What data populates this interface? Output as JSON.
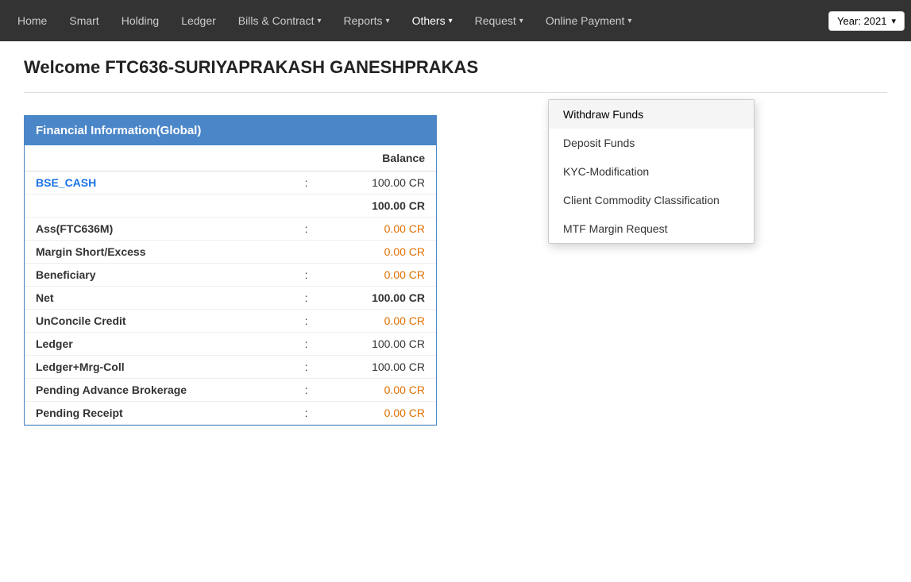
{
  "navbar": {
    "items": [
      {
        "id": "home",
        "label": "Home",
        "hasArrow": false
      },
      {
        "id": "smart",
        "label": "Smart",
        "hasArrow": false
      },
      {
        "id": "holding",
        "label": "Holding",
        "hasArrow": false
      },
      {
        "id": "ledger",
        "label": "Ledger",
        "hasArrow": false
      },
      {
        "id": "bills-contract",
        "label": "Bills & Contract",
        "hasArrow": true
      },
      {
        "id": "reports",
        "label": "Reports",
        "hasArrow": true
      },
      {
        "id": "others",
        "label": "Others",
        "hasArrow": true
      },
      {
        "id": "request",
        "label": "Request",
        "hasArrow": true
      },
      {
        "id": "online-payment",
        "label": "Online Payment",
        "hasArrow": true
      }
    ],
    "year_label": "Year: 2021"
  },
  "welcome": {
    "text": "Welcome FTC636-SURIYAPRAKASH GANESHPRAKAS"
  },
  "financial_table": {
    "header": "Financial Information(Global)",
    "column_balance": "Balance",
    "rows": [
      {
        "label": "BSE_CASH",
        "colon": ":",
        "value": "100.00 CR",
        "type": "link",
        "value_style": "normal"
      },
      {
        "label": "",
        "colon": "",
        "value": "100.00 CR",
        "type": "summary",
        "value_style": "bold"
      },
      {
        "label": "Ass(FTC636M)",
        "colon": ":",
        "value": "0.00 CR",
        "type": "normal",
        "value_style": "orange"
      },
      {
        "label": "Margin Short/Excess",
        "colon": "",
        "value": "0.00 CR",
        "type": "normal",
        "value_style": "orange"
      },
      {
        "label": "Beneficiary",
        "colon": ":",
        "value": "0.00 CR",
        "type": "normal",
        "value_style": "orange"
      },
      {
        "label": "Net",
        "colon": ":",
        "value": "100.00 CR",
        "type": "normal",
        "value_style": "bold"
      },
      {
        "label": "UnConcile Credit",
        "colon": ":",
        "value": "0.00 CR",
        "type": "normal",
        "value_style": "orange"
      },
      {
        "label": "Ledger",
        "colon": ":",
        "value": "100.00 CR",
        "type": "normal",
        "value_style": "normal"
      },
      {
        "label": "Ledger+Mrg-Coll",
        "colon": ":",
        "value": "100.00 CR",
        "type": "normal",
        "value_style": "normal"
      },
      {
        "label": "Pending Advance Brokerage",
        "colon": ":",
        "value": "0.00 CR",
        "type": "normal",
        "value_style": "orange"
      },
      {
        "label": "Pending Receipt",
        "colon": ":",
        "value": "0.00 CR",
        "type": "normal",
        "value_style": "orange"
      }
    ]
  },
  "dropdown": {
    "items": [
      {
        "id": "withdraw-funds",
        "label": "Withdraw Funds",
        "active": true
      },
      {
        "id": "deposit-funds",
        "label": "Deposit Funds",
        "active": false
      },
      {
        "id": "kyc-modification",
        "label": "KYC-Modification",
        "active": false
      },
      {
        "id": "client-commodity-classification",
        "label": "Client Commodity Classification",
        "active": false
      },
      {
        "id": "mtf-margin-request",
        "label": "MTF Margin Request",
        "active": false
      }
    ]
  }
}
